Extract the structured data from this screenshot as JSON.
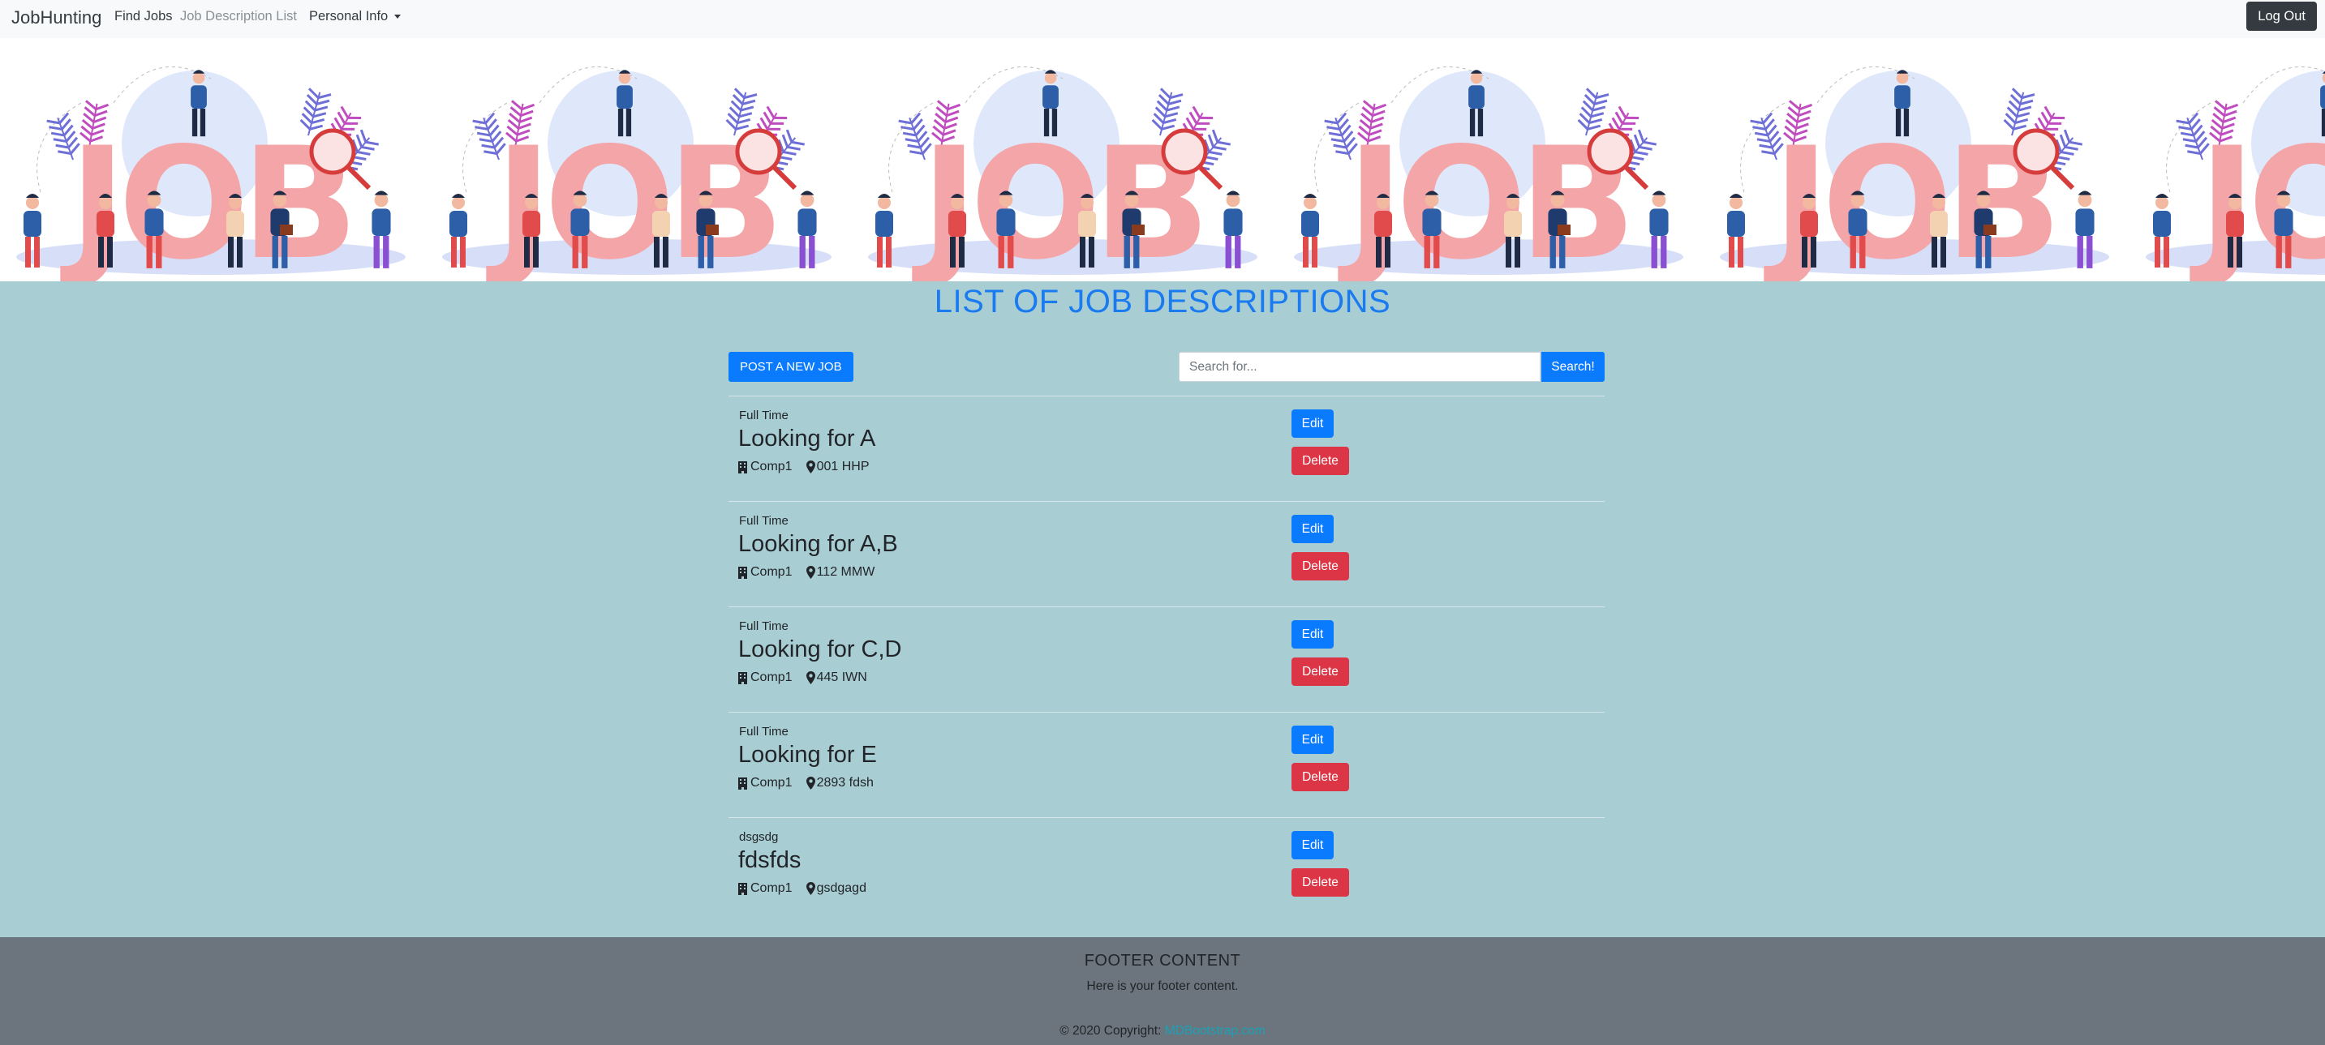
{
  "navbar": {
    "brand": "JobHunting",
    "links": [
      "Find Jobs",
      "Job Description List"
    ],
    "personal_info": "Personal Info",
    "logout": "Log Out"
  },
  "banner": {
    "tile_word": "JOB"
  },
  "page": {
    "title": "LIST OF JOB DESCRIPTIONS",
    "post_button": "POST A NEW JOB",
    "search_placeholder": "Search for...",
    "search_button": "Search!"
  },
  "jobs": [
    {
      "type": "Full Time",
      "title": "Looking for A",
      "company": "Comp1",
      "location": "001 HHP",
      "edit": "Edit",
      "delete": "Delete"
    },
    {
      "type": "Full Time",
      "title": "Looking for A,B",
      "company": "Comp1",
      "location": "112 MMW",
      "edit": "Edit",
      "delete": "Delete"
    },
    {
      "type": "Full Time",
      "title": "Looking for C,D",
      "company": "Comp1",
      "location": "445 IWN",
      "edit": "Edit",
      "delete": "Delete"
    },
    {
      "type": "Full Time",
      "title": "Looking for E",
      "company": "Comp1",
      "location": "2893 fdsh",
      "edit": "Edit",
      "delete": "Delete"
    },
    {
      "type": "dsgsdg",
      "title": "fdsfds",
      "company": "Comp1",
      "location": "gsdgagd",
      "edit": "Edit",
      "delete": "Delete"
    }
  ],
  "footer": {
    "title": "FOOTER CONTENT",
    "text": "Here is your footer content.",
    "copyright": "© 2020 Copyright:",
    "link": "MDBootstrap.com"
  },
  "colors": {
    "page_bg": "#a8cdd3",
    "primary": "#0a7bff",
    "danger": "#dc3545",
    "title": "#1a7bf0",
    "footer_bg": "#6c757d",
    "dark": "#343a40"
  }
}
